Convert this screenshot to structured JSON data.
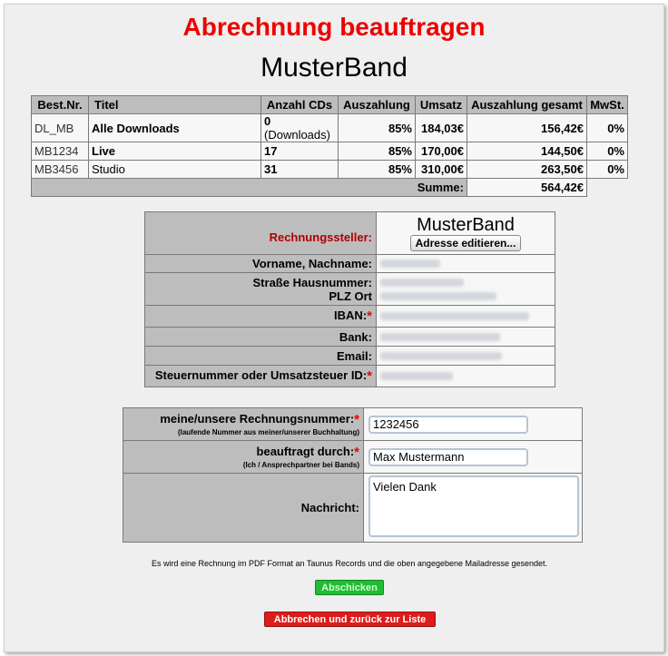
{
  "page": {
    "title": "Abrechnung beauftragen",
    "band_name": "MusterBand"
  },
  "orders_table": {
    "headers": [
      "Best.Nr.",
      "Titel",
      "Anzahl CDs",
      "Auszahlung",
      "Umsatz",
      "Auszahlung gesamt",
      "MwSt."
    ],
    "rows": [
      {
        "nr": "DL_MB",
        "titel": "Alle Downloads",
        "anzahl": "0",
        "anzahl_suffix": " (Downloads)",
        "auszahlung": "85%",
        "umsatz": "184,03€",
        "gesamt": "156,42€",
        "mwst": "0%"
      },
      {
        "nr": "MB1234",
        "titel": "Live",
        "anzahl": "17",
        "anzahl_suffix": "",
        "auszahlung": "85%",
        "umsatz": "170,00€",
        "gesamt": "144,50€",
        "mwst": "0%"
      },
      {
        "nr": "MB3456",
        "titel": "Studio",
        "anzahl": "31",
        "anzahl_suffix": "",
        "auszahlung": "85%",
        "umsatz": "310,00€",
        "gesamt": "263,50€",
        "mwst": "0%"
      }
    ],
    "sum_label": "Summe:",
    "sum_value": "564,42€"
  },
  "biller": {
    "label": "Rechnungssteller:",
    "name": "MusterBand",
    "edit_button": "Adresse editieren...",
    "fields": {
      "name_label": "Vorname, Nachname:",
      "street_label": "Straße Hausnummer:",
      "city_label": "PLZ Ort",
      "iban_label": "IBAN:",
      "bank_label": "Bank:",
      "email_label": "Email:",
      "tax_label": "Steuernummer oder Umsatzsteuer ID:"
    },
    "required_mark": "*"
  },
  "invoice_form": {
    "number_label": "meine/unsere Rechnungsnummer:",
    "number_hint": "(laufende Nummer aus meiner/unserer Buchhaltung)",
    "number_value": "1232456",
    "by_label": "beauftragt durch:",
    "by_hint": "(Ich / Ansprechpartner bei Bands)",
    "by_value": "Max Mustermann",
    "message_label": "Nachricht:",
    "message_value": "Vielen Dank"
  },
  "note": "Es wird eine Rechnung im PDF Format an Taunus Records und die oben angegebene Mailadresse gesendet.",
  "buttons": {
    "submit": "Abschicken",
    "cancel": "Abbrechen und zurück zur Liste"
  },
  "colors": {
    "title": "#ee0000",
    "submit_button": "#22bb33",
    "cancel_button": "#dd1c1c",
    "label_background": "#bdbdbd"
  }
}
